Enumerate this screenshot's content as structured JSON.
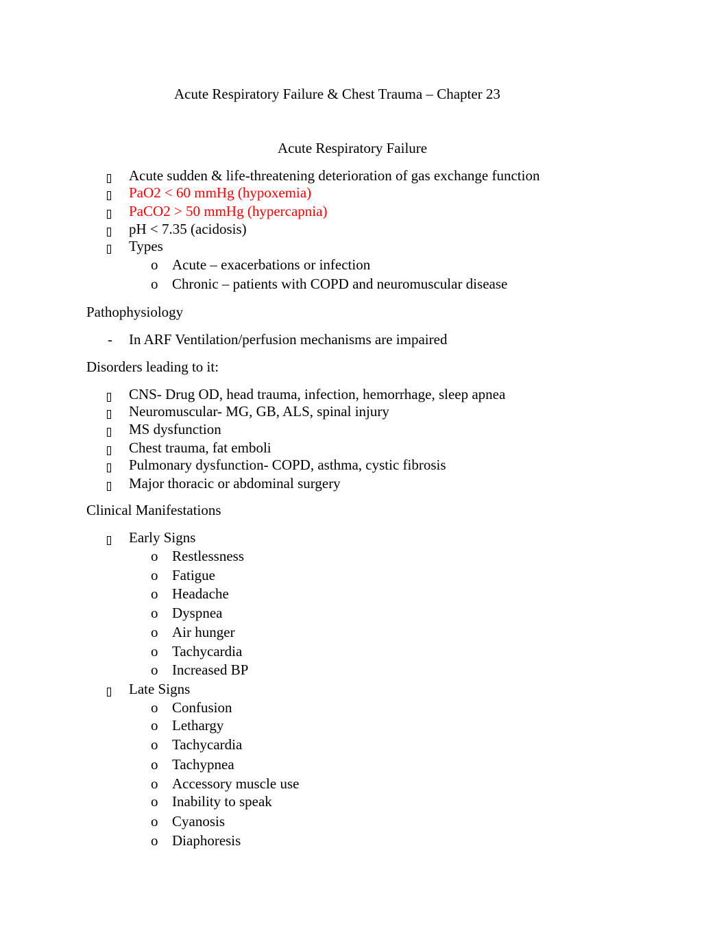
{
  "doc_title": "Acute Respiratory Failure & Chest Trauma – Chapter 23",
  "section_title": "Acute Respiratory Failure",
  "text_colors": {
    "default": "#000000",
    "highlight": "#ff0000"
  },
  "bullet_icons": {
    "level1": "missing-glyph-box",
    "level2": "o",
    "dash": "-"
  },
  "intro_list": [
    {
      "text": "Acute sudden & life-threatening deterioration of gas exchange function",
      "highlight": false
    },
    {
      "text": "PaO2 < 60 mmHg (hypoxemia)",
      "highlight": true
    },
    {
      "text": "PaCO2 > 50 mmHg (hypercapnia)",
      "highlight": true
    },
    {
      "text": "pH < 7.35 (acidosis)",
      "highlight": false
    },
    {
      "text": "Types",
      "highlight": false,
      "children": [
        "Acute – exacerbations or infection",
        "Chronic – patients with COPD and neuromuscular disease"
      ]
    }
  ],
  "pathophysiology": {
    "heading": "Pathophysiology",
    "dash_bullet": "-",
    "items": [
      "In ARF Ventilation/perfusion mechanisms are impaired"
    ]
  },
  "disorders": {
    "heading": "Disorders leading to it:",
    "items": [
      "CNS- Drug OD, head trauma, infection, hemorrhage, sleep apnea",
      "Neuromuscular- MG, GB, ALS, spinal injury",
      "MS dysfunction",
      "Chest trauma, fat emboli",
      "Pulmonary dysfunction- COPD, asthma, cystic fibrosis",
      "Major thoracic or abdominal surgery"
    ]
  },
  "clinical": {
    "heading": "Clinical Manifestations",
    "sub_bullet": "o",
    "early": {
      "label": "Early Signs",
      "items": [
        "Restlessness",
        "Fatigue",
        "Headache",
        "Dyspnea",
        "Air hunger",
        "Tachycardia",
        "Increased BP"
      ]
    },
    "late": {
      "label": "Late Signs",
      "items": [
        "Confusion",
        "Lethargy",
        "Tachycardia",
        "Tachypnea",
        "Accessory muscle use",
        "Inability to speak",
        "Cyanosis",
        "Diaphoresis"
      ]
    }
  }
}
